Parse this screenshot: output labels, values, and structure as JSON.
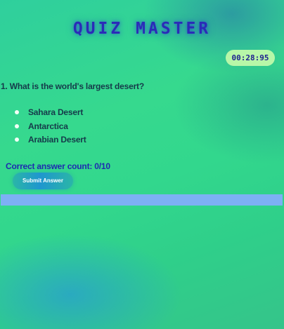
{
  "title": "QUIZ MASTER",
  "timer": "00:28:95",
  "question": "1. What is the world's largest desert?",
  "answers": [
    {
      "label": "Sahara Desert"
    },
    {
      "label": "Antarctica"
    },
    {
      "label": "Arabian Desert"
    }
  ],
  "score_text": "Correct answer count: 0/10",
  "submit_label": "Submit Answer",
  "colors": {
    "title": "#2b2bb8",
    "timer_bg": "#b7f7a8",
    "progress_bar": "#7db0f4"
  }
}
